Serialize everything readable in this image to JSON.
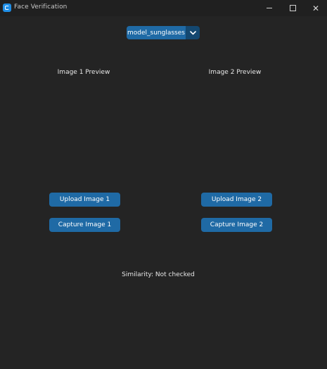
{
  "window": {
    "title": "Face Verification"
  },
  "model_selector": {
    "selected": "model_sunglasses"
  },
  "previews": {
    "image1_label": "Image 1 Preview",
    "image2_label": "Image 2 Preview"
  },
  "buttons": {
    "upload1": "Upload Image 1",
    "upload2": "Upload Image 2",
    "capture1": "Capture Image 1",
    "capture2": "Capture Image 2"
  },
  "status": {
    "similarity": "Similarity: Not checked"
  },
  "colors": {
    "background": "#242424",
    "accent": "#1f6aa5",
    "accent_dark": "#144870"
  }
}
